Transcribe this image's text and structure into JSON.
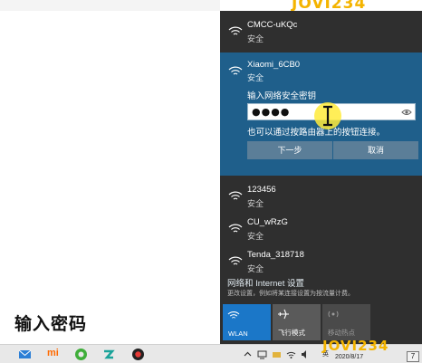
{
  "watermark": "JOVI234",
  "caption": "输入密码",
  "networks": [
    {
      "name": "CMCC-uKQc",
      "status": "安全"
    },
    {
      "name": "Xiaomi_6CB0",
      "status": "安全"
    },
    {
      "name": "123456",
      "status": "安全"
    },
    {
      "name": "CU_wRzG",
      "status": "安全"
    },
    {
      "name": "Tenda_318718",
      "status": "安全"
    }
  ],
  "connect": {
    "key_label": "输入网络安全密钥",
    "password_mask": "●●●●",
    "router_hint": "也可以通过按路由器上的按钮连接。",
    "next_label": "下一步",
    "cancel_label": "取消"
  },
  "settings": {
    "link": "网络和 Internet 设置",
    "desc": "更改设置，例如将某连接设置为按流量计费。"
  },
  "tiles": [
    {
      "label": "WLAN"
    },
    {
      "label": "飞行模式"
    },
    {
      "label": "移动热点"
    }
  ],
  "taskbar": {
    "mi_label": "mi",
    "lang": "英",
    "date": "2020/8/17",
    "badge": "7"
  },
  "colors": {
    "panel_bg": "#2f2f2f",
    "active_bg": "#1f5f8b",
    "wlan_tile": "#1b77c8",
    "cursor_highlight": "#ffeb3b"
  }
}
